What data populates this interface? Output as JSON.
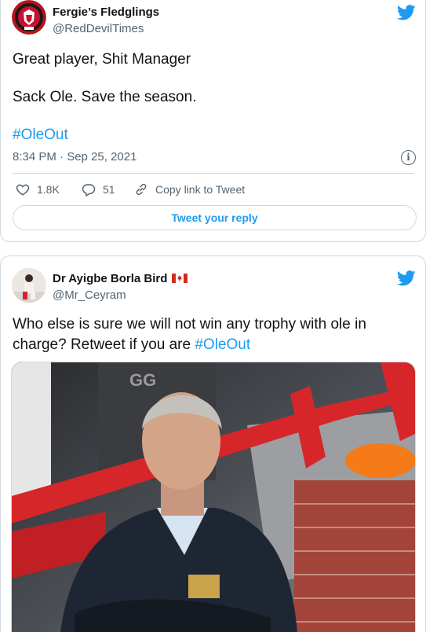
{
  "tweet1": {
    "display_name": "Fergie’s Fledglings",
    "handle": "@RedDevilTimes",
    "line1": "Great player, Shit Manager",
    "line2": "Sack Ole. Save the season.",
    "hashtag": "#OleOut",
    "timestamp": "8:34 PM · Sep 25, 2021",
    "likes": "1.8K",
    "replies": "51",
    "copy_link": "Copy link to Tweet",
    "reply_button": "Tweet your reply",
    "avatar_icon": "team-crest-avatar",
    "colors": {
      "accent": "#1d9bf0",
      "avatar_red": "#b4141e"
    }
  },
  "tweet2": {
    "display_name": "Dr Ayigbe Borla Bird",
    "flag": "canada-flag-icon",
    "handle": "@Mr_Ceyram",
    "text": "Who else is sure we will not win any trophy with ole in charge? Retweet if you are",
    "hashtag": "#OleOut",
    "media_sign": "GG"
  }
}
